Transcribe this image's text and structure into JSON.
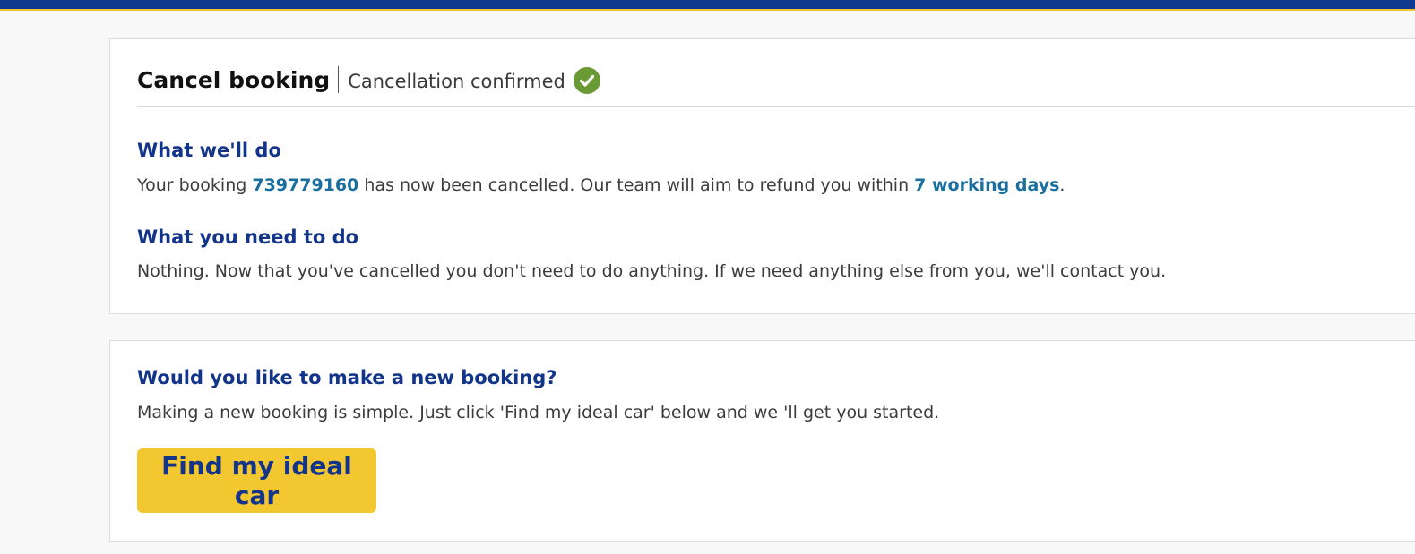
{
  "colors": {
    "brand_blue": "#0f3a8f",
    "heading_blue": "#12358a",
    "highlight_blue": "#1a6f9e",
    "accent_yellow": "#f2c730",
    "success_green": "#6a9a35"
  },
  "header": {
    "title": "Cancel booking",
    "status": "Cancellation confirmed",
    "status_icon": "check-circle-icon"
  },
  "what_we_do": {
    "heading": "What we'll do",
    "text_before": "Your booking ",
    "booking_number": "739779160",
    "text_middle": " has now been cancelled. Our team will aim to refund you within ",
    "refund_period": "7 working days",
    "text_after": "."
  },
  "what_you_do": {
    "heading": "What you need to do",
    "text": "Nothing. Now that you've cancelled you don't need to do anything. If we need anything else from you, we'll contact you."
  },
  "new_booking": {
    "heading": "Would you like to make a new booking?",
    "text": "Making a new booking is simple. Just click 'Find my ideal car' below and we 'll get you started.",
    "button_label": "Find my ideal car"
  }
}
